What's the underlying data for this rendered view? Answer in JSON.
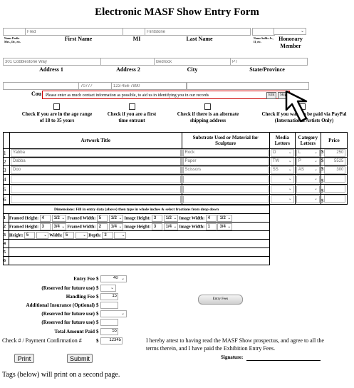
{
  "title": "Electronic MASF Show Entry Form",
  "name": {
    "first_value": "Fred",
    "mi_value": "",
    "last_value": "Flintstone",
    "suffix_value": "",
    "honorary_value": "",
    "labels": {
      "prefix": "Name Prefix Mrs., Dr., etc.",
      "first": "First Name",
      "mi": "MI",
      "last": "Last Name",
      "suffix": "Name Suffix Jr., II, etc.",
      "honorary": "Honorary Member"
    }
  },
  "address": {
    "address1_value": "301 Cobblestone Way",
    "address2_value": "",
    "city_value": "Bedrock",
    "state_value": "PT",
    "labels": {
      "address1": "Address 1",
      "address2": "Address 2",
      "city": "City",
      "state": "State/Province"
    }
  },
  "contact": {
    "zip_value": "70777",
    "phone_value": "123-456-7890",
    "country_label_partial": "Cou",
    "tooltip_text": "Please enter as much contact information as possible, to aid us in identifying you in our records",
    "tooltip_edit": "Edit",
    "tooltip_skip": "Skip"
  },
  "checkboxes": [
    {
      "label": "Check if you are in the age range of 18 to 35 years"
    },
    {
      "label": "Check if you are a first time entrant"
    },
    {
      "label": "Check if there is an alternate shipping address"
    },
    {
      "label": "Check if you want to be paid via PayPal (International Artists Only)"
    }
  ],
  "artwork_table": {
    "headers": {
      "title": "Artwork Title",
      "substrate": "Substrate Used or Material for Sculpture",
      "media": "Media Letters",
      "category": "Category Letters",
      "price": "Price"
    },
    "rows": [
      {
        "num": "1",
        "title": "Yabba",
        "substrate": "Rock",
        "media": "O",
        "category": "L",
        "price": "250"
      },
      {
        "num": "2",
        "title": "Dabba",
        "substrate": "Paper",
        "media": "TW",
        "category": "P",
        "price": "5525"
      },
      {
        "num": "3",
        "title": "Doo",
        "substrate": "Scissors",
        "media": "SS",
        "category": "AS",
        "price": "300"
      },
      {
        "num": "4",
        "title": "",
        "substrate": "",
        "media": "",
        "category": "",
        "price": ""
      },
      {
        "num": "5",
        "title": "",
        "substrate": "",
        "media": "",
        "category": "",
        "price": ""
      },
      {
        "num": "6",
        "title": "",
        "substrate": "",
        "media": "",
        "category": "",
        "price": ""
      }
    ],
    "currency": "$"
  },
  "dimensions": {
    "header": "Dimensions: Fill in entry data (above) then type in whole inches & select fractions from drop down",
    "labels": {
      "framed_height": "Framed Height:",
      "framed_width": "Framed Width:",
      "image_height": "Image Height:",
      "image_width": "Image Width:",
      "height": "Height:",
      "width": "Width:",
      "depth": "Depth:"
    },
    "rows": [
      {
        "num": "1",
        "fh": "4",
        "fhf": "1/2",
        "fw": "5",
        "fwf": "1/2",
        "ih": "3",
        "ihf": "1/2",
        "iw": "4",
        "iwf": "1/2"
      },
      {
        "num": "2",
        "fh": "3",
        "fhf": "3/4",
        "fw": "2",
        "fwf": "1/4",
        "ih": "3",
        "ihf": "1/4",
        "iw": "1",
        "iwf": "3/4"
      },
      {
        "num": "3",
        "h": "5",
        "w": "5",
        "d": "3"
      },
      {
        "num": "4"
      },
      {
        "num": "5"
      },
      {
        "num": "6"
      }
    ]
  },
  "fees": {
    "entry_fee_label": "Entry Fee",
    "entry_fee_value": "40",
    "reserved_label": "(Reserved for future use)",
    "handling_label": "Handling Fee",
    "handling_value": "15",
    "insurance_label": "Additional Insurance (Optional)",
    "total_label": "Total Amount Paid",
    "total_value": "55",
    "check_label": "Check # / Payment Confirmation #",
    "check_value": "12345",
    "currency": "$",
    "entry_fees_button": "Entry Fees"
  },
  "attest_text": "I hereby attest to having read the MASF Show prospectus, and agree to all the terms therein, and I have paid the Exhibition Entry Fees.",
  "signature_label": "Signature:",
  "buttons": {
    "print": "Print",
    "submit": "Submit"
  },
  "footer_text": "Tags (below) will print on a second page."
}
